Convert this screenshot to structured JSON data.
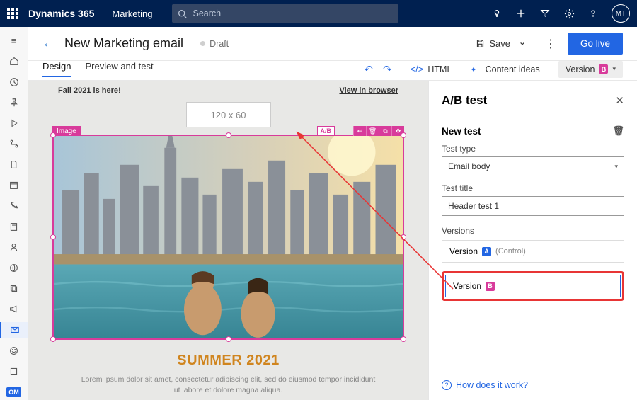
{
  "topbar": {
    "brand": "Dynamics 365",
    "module": "Marketing",
    "search_placeholder": "Search",
    "avatar_initials": "MT"
  },
  "header": {
    "title": "New Marketing email",
    "status": "Draft",
    "save_label": "Save",
    "golive_label": "Go live"
  },
  "tabs": {
    "design": "Design",
    "preview": "Preview and test",
    "html_label": "HTML",
    "content_ideas": "Content ideas",
    "version_prefix": "Version",
    "version_letter": "B"
  },
  "canvas": {
    "preheader": "Fall 2021 is here!",
    "view_in_browser": "View in browser",
    "logo_placeholder": "120 x 60",
    "sel_label": "Image",
    "ab_chip": "A/B",
    "heading": "SUMMER 2021",
    "lorem": "Lorem ipsum dolor sit amet, consectetur adipiscing elit, sed do eiusmod tempor incididunt ut labore et dolore magna aliqua."
  },
  "panel": {
    "title": "A/B test",
    "new_test": "New test",
    "test_type_label": "Test type",
    "test_type_value": "Email body",
    "test_title_label": "Test title",
    "test_title_value": "Header test 1",
    "versions_label": "Versions",
    "version_a_prefix": "Version",
    "version_a_letter": "A",
    "version_a_tag": "(Control)",
    "version_b_prefix": "Version",
    "version_b_letter": "B",
    "help": "How does it work?"
  }
}
